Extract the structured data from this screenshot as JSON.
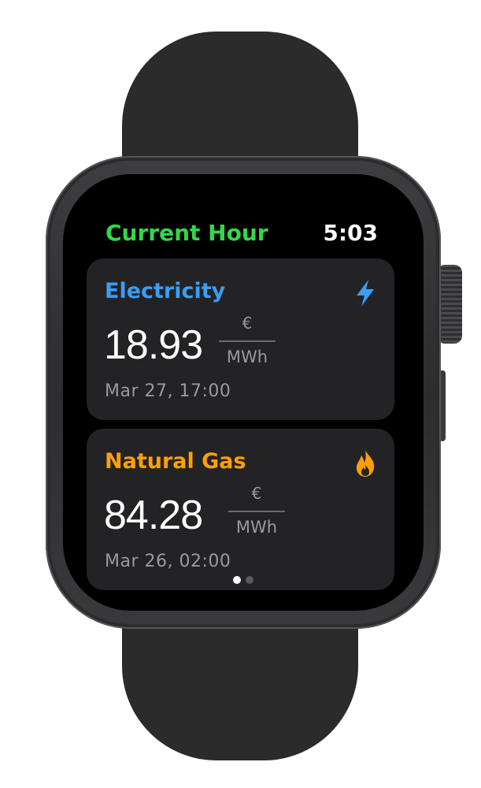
{
  "header": {
    "title": "Current Hour",
    "time": "5:03"
  },
  "cards": [
    {
      "title": "Electricity",
      "icon": "bolt-icon",
      "color": "#3a9ef5",
      "value": "18.93",
      "unit_top": "€",
      "unit_bottom": "MWh",
      "date": "Mar 27, 17:00"
    },
    {
      "title": "Natural Gas",
      "icon": "flame-icon",
      "color": "#ff9f0a",
      "value": "84.28",
      "unit_top": "€",
      "unit_bottom": "MWh",
      "date": "Mar 26, 02:00"
    }
  ],
  "colors": {
    "title": "#32d74b",
    "card_background": "#232325"
  },
  "pagination": {
    "current_page": 1,
    "total_pages": 2
  }
}
